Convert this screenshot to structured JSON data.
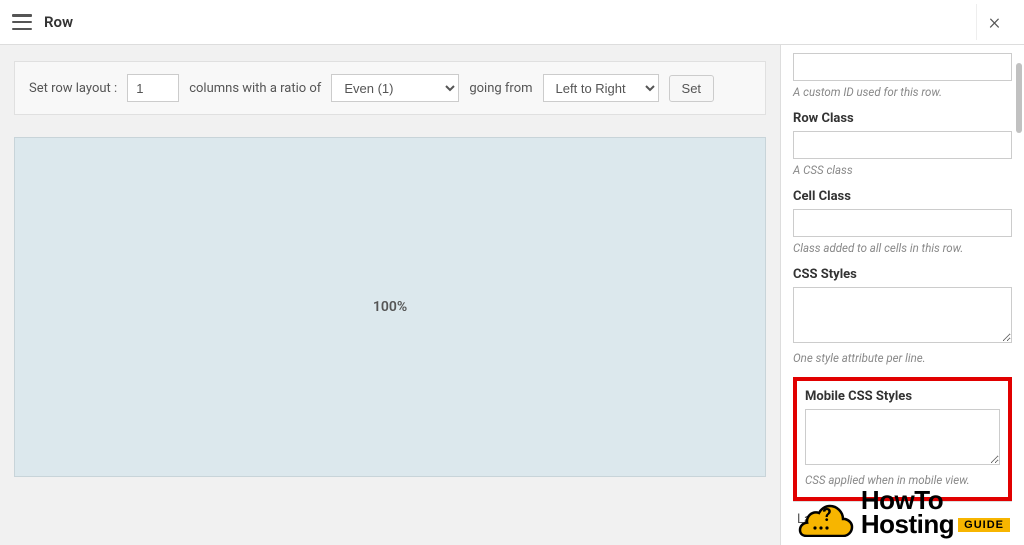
{
  "header": {
    "title": "Row"
  },
  "toolbar": {
    "label_prefix": "Set row layout :",
    "columns_value": "1",
    "label_ratio": "columns with a ratio of",
    "ratio_options": [
      "Even (1)"
    ],
    "ratio_selected": "Even (1)",
    "label_going": "going from",
    "direction_options": [
      "Left to Right"
    ],
    "direction_selected": "Left to Right",
    "set_label": "Set"
  },
  "preview": {
    "cell_label": "100%"
  },
  "sidebar": {
    "custom_id_hint": "A custom ID used for this row.",
    "row_class": {
      "label": "Row Class",
      "value": "",
      "hint": "A CSS class"
    },
    "cell_class": {
      "label": "Cell Class",
      "value": "",
      "hint": "Class added to all cells in this row."
    },
    "css_styles": {
      "label": "CSS Styles",
      "value": "",
      "hint": "One style attribute per line."
    },
    "mobile_css": {
      "label": "Mobile CSS Styles",
      "value": "",
      "hint": "CSS applied when in mobile view."
    },
    "collapsed_layout": "Layout"
  },
  "logo": {
    "line1": "HowTo",
    "line2": "Hosting",
    "badge": "GUIDE"
  }
}
